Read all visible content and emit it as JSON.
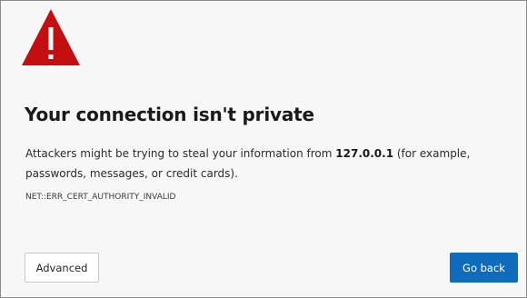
{
  "icon": {
    "name": "warning-triangle-icon",
    "color": "#c50f0f",
    "glyph": "!"
  },
  "heading": "Your connection isn't private",
  "description": {
    "before": "Attackers might be trying to steal your information from ",
    "host": "127.0.0.1",
    "after": " (for example, passwords, messages, or credit cards)."
  },
  "error_code": "NET::ERR_CERT_AUTHORITY_INVALID",
  "buttons": {
    "advanced_label": "Advanced",
    "back_label": "Go back"
  },
  "colors": {
    "primary_button": "#0f6cbd",
    "warning": "#c50f0f"
  }
}
